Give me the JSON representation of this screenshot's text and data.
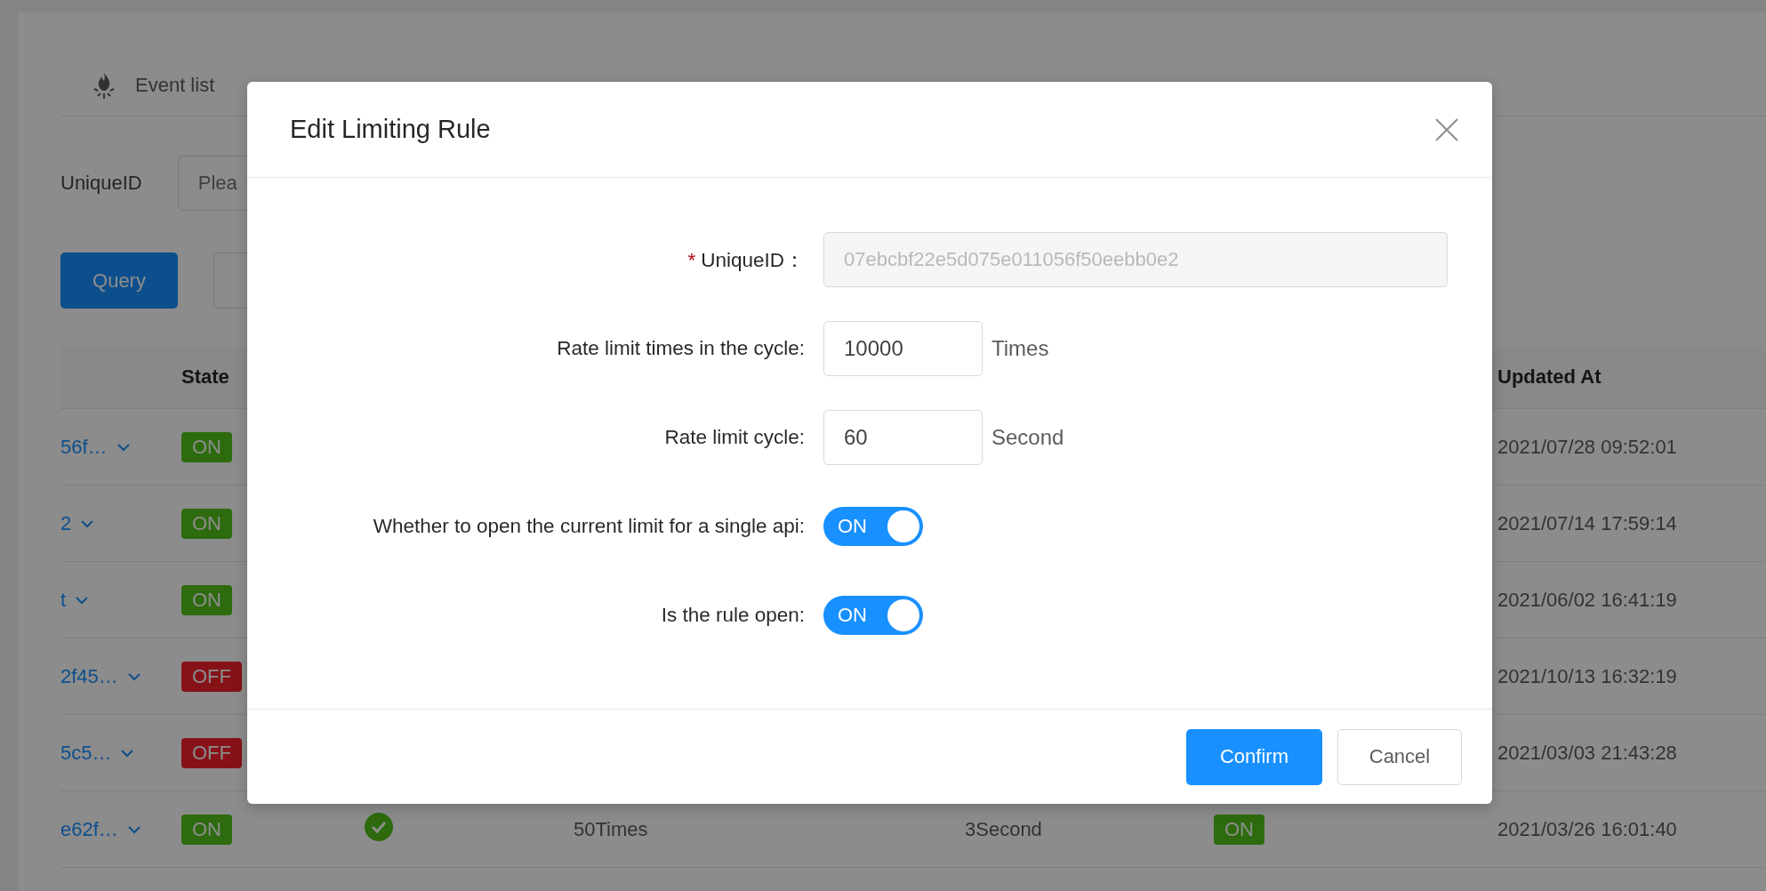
{
  "page": {
    "tabs": [
      {
        "label": "Event list",
        "selected": false
      }
    ],
    "filter": {
      "label": "UniqueID",
      "placeholder": "Plea"
    },
    "buttons": [
      {
        "label": "Query",
        "kind": "primary"
      },
      {
        "kind": "default"
      }
    ],
    "table": {
      "header": {
        "state": "State",
        "updated_at": "Updated At"
      },
      "rows": [
        {
          "id": "56f…",
          "state": {
            "label": "ON",
            "on": true
          },
          "updated_at": "2021/07/28 09:52:01"
        },
        {
          "id": "2",
          "state": {
            "label": "ON",
            "on": true
          },
          "updated_at": "2021/07/14 17:59:14"
        },
        {
          "id": "t",
          "state": {
            "label": "ON",
            "on": true
          },
          "updated_at": "2021/06/02 16:41:19"
        },
        {
          "id": "2f45…",
          "state": {
            "label": "OFF",
            "on": false
          },
          "updated_at": "2021/10/13 16:32:19"
        },
        {
          "id": "5c5…",
          "state": {
            "label": "OFF",
            "on": false
          },
          "updated_at": "2021/03/03 21:43:28"
        },
        {
          "id": "e62f…",
          "state": {
            "label": "ON",
            "on": true
          },
          "check": true,
          "times": "50Times",
          "cycle": "3Second",
          "single_api": {
            "label": "ON",
            "on": true
          },
          "updated_at": "2021/03/26 16:01:40"
        }
      ]
    }
  },
  "modal": {
    "title": "Edit Limiting Rule",
    "fields": [
      {
        "kind": "text",
        "label": "UniqueID：",
        "required_mark": "*",
        "value": "07ebcbf22e5d075e011056f50eebb0e2",
        "disabled": true
      },
      {
        "kind": "number",
        "label": "Rate limit times in the cycle:",
        "value": "10000",
        "suffix": "Times"
      },
      {
        "kind": "number",
        "label": "Rate limit cycle:",
        "value": "60",
        "suffix": "Second"
      },
      {
        "kind": "switch",
        "label": "Whether to open the current limit for a single api:",
        "on": true,
        "text": "ON"
      },
      {
        "kind": "switch",
        "label": "Is the rule open:",
        "on": true,
        "text": "ON"
      }
    ],
    "buttons": [
      {
        "label": "Confirm",
        "kind": "primary"
      },
      {
        "label": "Cancel",
        "kind": "default"
      }
    ]
  }
}
